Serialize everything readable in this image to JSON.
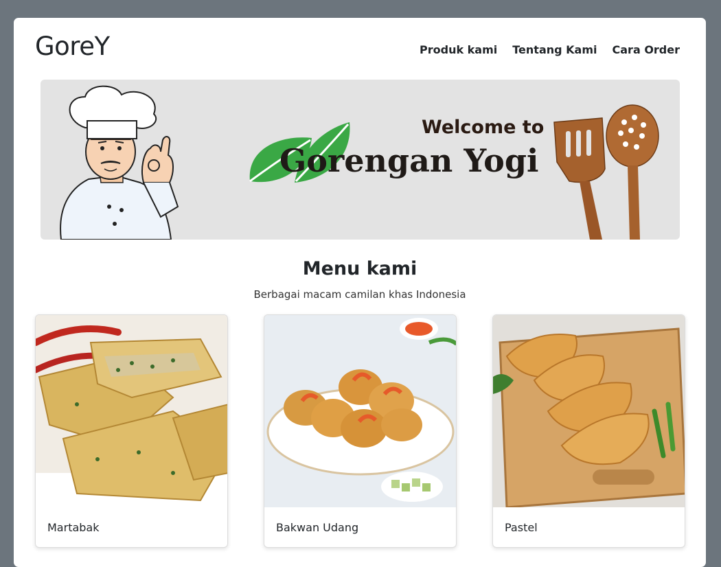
{
  "brand": "GoreY",
  "nav": [
    "Produk kami",
    "Tentang Kami",
    "Cara Order"
  ],
  "banner": {
    "welcome": "Welcome to",
    "title": "Gorengan Yogi"
  },
  "menu": {
    "title": "Menu kami",
    "subtitle": "Berbagai macam camilan khas Indonesia",
    "items": [
      {
        "name": "Martabak"
      },
      {
        "name": "Bakwan Udang"
      },
      {
        "name": "Pastel"
      }
    ]
  },
  "colors": {
    "background": "#6c757d",
    "card": "#ffffff",
    "banner": "#e3e3e3",
    "leaf": "#3aa845",
    "wood": "#a5612d"
  }
}
